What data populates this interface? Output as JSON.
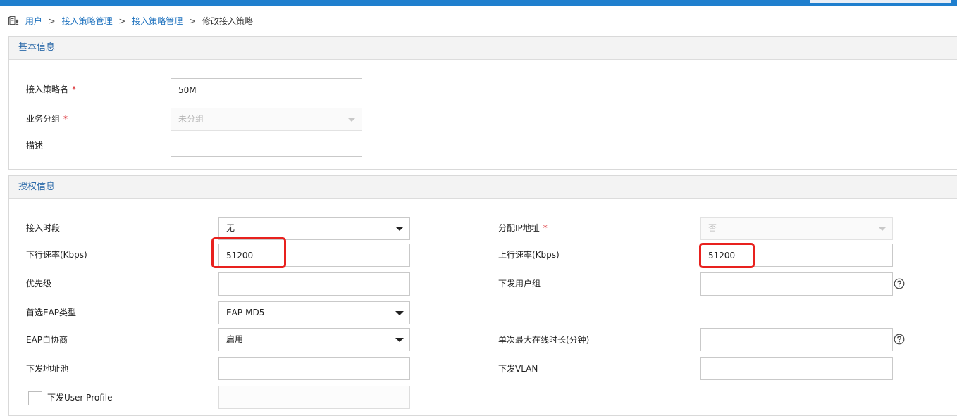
{
  "breadcrumb": {
    "items": [
      "用户",
      "接入策略管理",
      "接入策略管理"
    ],
    "separator": ">",
    "current": "修改接入策略"
  },
  "basic": {
    "title": "基本信息",
    "policy_name": {
      "label": "接入策略名",
      "required_mark": "*",
      "value": "50M"
    },
    "service_group": {
      "label": "业务分组",
      "required_mark": "*",
      "value": "未分组"
    },
    "description": {
      "label": "描述",
      "value": ""
    }
  },
  "auth": {
    "title": "授权信息",
    "access_period": {
      "label": "接入时段",
      "value": "无"
    },
    "assign_ip": {
      "label": "分配IP地址",
      "required_mark": "*",
      "value": "否"
    },
    "downlink_rate": {
      "label": "下行速率(Kbps)",
      "value": "51200"
    },
    "uplink_rate": {
      "label": "上行速率(Kbps)",
      "value": "51200"
    },
    "priority": {
      "label": "优先级",
      "value": ""
    },
    "user_group": {
      "label": "下发用户组",
      "value": ""
    },
    "eap_type": {
      "label": "首选EAP类型",
      "value": "EAP-MD5"
    },
    "eap_negotiation": {
      "label": "EAP自协商",
      "value": "启用"
    },
    "max_online": {
      "label": "单次最大在线时长(分钟)",
      "value": ""
    },
    "address_pool": {
      "label": "下发地址池",
      "value": ""
    },
    "vlan": {
      "label": "下发VLAN",
      "value": ""
    },
    "user_profile": {
      "label": "下发User Profile",
      "checked": false,
      "value": ""
    }
  },
  "colors": {
    "accent": "#1f7fce",
    "link": "#1a6fbd",
    "section_title": "#2c6aa9",
    "required": "#d9262c",
    "highlight": "#e8211e"
  },
  "icons": {
    "breadcrumb": "user-manage-icon",
    "help": "question-circle-icon",
    "dropdown": "chevron-down-icon"
  }
}
